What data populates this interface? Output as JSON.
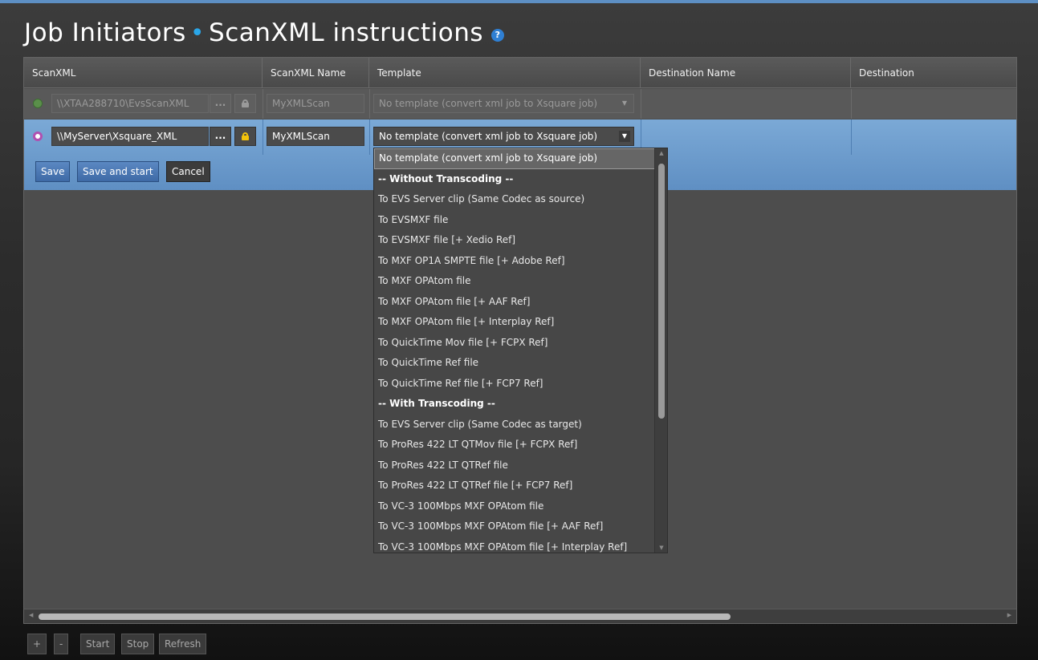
{
  "header": {
    "title_part1": "Job Initiators",
    "title_part2": "ScanXML instructions",
    "help_label": "?"
  },
  "table": {
    "columns": [
      "ScanXML",
      "ScanXML Name",
      "Template",
      "Destination Name",
      "Destination"
    ],
    "rows": [
      {
        "status_color": "#5a8f4a",
        "path": "\\\\XTAA288710\\EvsScanXML",
        "browse_label": "...",
        "name": "MyXMLScan",
        "template": "No template (convert xml job to Xsquare job)"
      },
      {
        "status_color": "#b050b0",
        "path": "\\\\MyServer\\Xsquare_XML",
        "browse_label": "...",
        "name": "MyXMLScan",
        "template": "No template (convert xml job to Xsquare job)"
      }
    ]
  },
  "edit_actions": {
    "save": "Save",
    "save_and_start": "Save and start",
    "cancel": "Cancel"
  },
  "template_dropdown": {
    "items": [
      {
        "label": "No template (convert xml job to Xsquare job)",
        "kind": "selected"
      },
      {
        "label": "-- Without Transcoding --",
        "kind": "group"
      },
      {
        "label": "To EVS Server clip (Same Codec as source)",
        "kind": "option"
      },
      {
        "label": "To EVSMXF file",
        "kind": "option"
      },
      {
        "label": "To EVSMXF file [+ Xedio Ref]",
        "kind": "option"
      },
      {
        "label": "To MXF OP1A SMPTE file [+ Adobe Ref]",
        "kind": "option"
      },
      {
        "label": "To MXF OPAtom file",
        "kind": "option"
      },
      {
        "label": "To MXF OPAtom file [+ AAF Ref]",
        "kind": "option"
      },
      {
        "label": "To MXF OPAtom file [+ Interplay Ref]",
        "kind": "option"
      },
      {
        "label": "To QuickTime Mov file [+ FCPX Ref]",
        "kind": "option"
      },
      {
        "label": "To QuickTime Ref file",
        "kind": "option"
      },
      {
        "label": "To QuickTime Ref file [+ FCP7 Ref]",
        "kind": "option"
      },
      {
        "label": "-- With Transcoding --",
        "kind": "group"
      },
      {
        "label": "To EVS Server clip (Same Codec as target)",
        "kind": "option"
      },
      {
        "label": "To ProRes 422 LT QTMov file [+ FCPX Ref]",
        "kind": "option"
      },
      {
        "label": "To ProRes 422 LT QTRef file",
        "kind": "option"
      },
      {
        "label": "To ProRes 422 LT QTRef file [+ FCP7 Ref]",
        "kind": "option"
      },
      {
        "label": "To VC-3 100Mbps MXF OPAtom file",
        "kind": "option"
      },
      {
        "label": "To VC-3 100Mbps MXF OPAtom file [+ AAF Ref]",
        "kind": "option"
      },
      {
        "label": "To VC-3 100Mbps MXF OPAtom file [+ Interplay Ref]",
        "kind": "option"
      }
    ]
  },
  "footer": {
    "add": "+",
    "remove": "-",
    "start": "Start",
    "stop": "Stop",
    "refresh": "Refresh"
  },
  "colors": {
    "accent": "#2aa6e8",
    "selected_row": "#6f9fd0",
    "panel": "#4d4d4d"
  }
}
